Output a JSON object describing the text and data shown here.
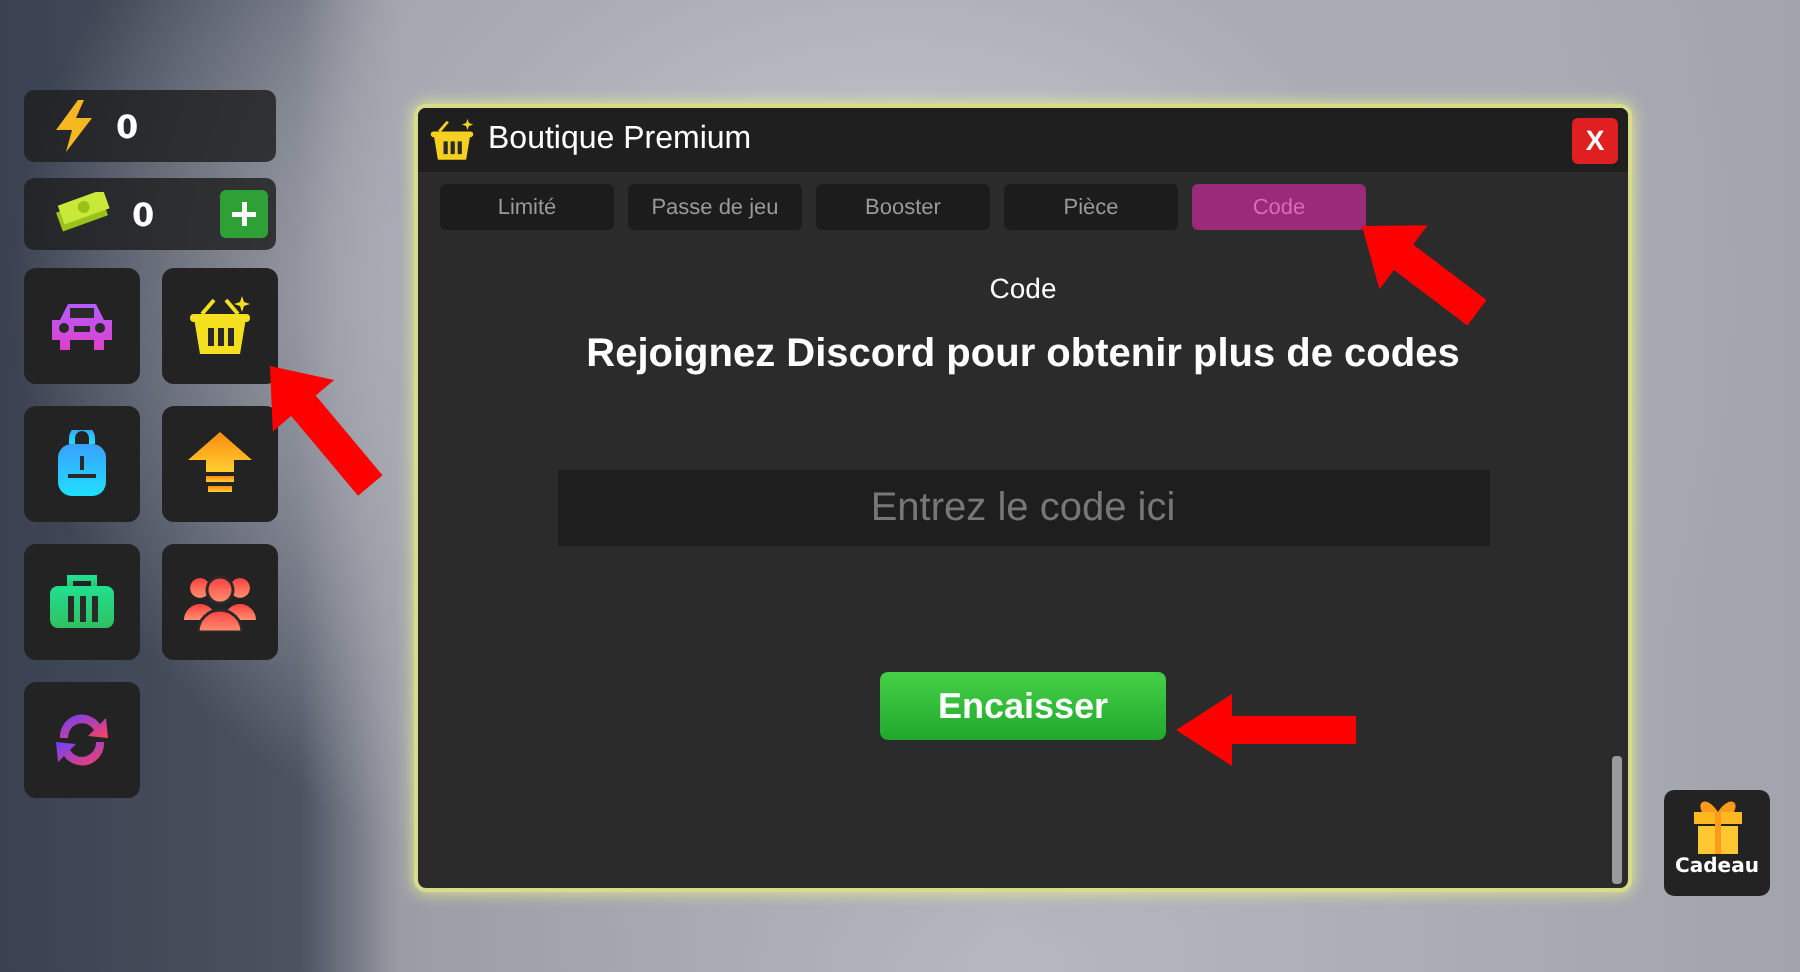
{
  "hud": {
    "stats": [
      {
        "kind": "energy",
        "value": "0"
      },
      {
        "kind": "cash",
        "value": "0"
      }
    ]
  },
  "shop": {
    "title": "Boutique Premium",
    "close": "X",
    "tabs": [
      {
        "label": "Limité",
        "selected": false
      },
      {
        "label": "Passe de jeu",
        "selected": false
      },
      {
        "label": "Booster",
        "selected": false
      },
      {
        "label": "Pièce",
        "selected": false
      },
      {
        "label": "Code",
        "selected": true
      }
    ],
    "heading": "Code",
    "message": "Rejoignez Discord pour obtenir plus de codes",
    "code_field": {
      "placeholder": "Entrez le code ici"
    },
    "redeem_button": "Encaisser"
  },
  "gift": {
    "label": "Cadeau"
  }
}
